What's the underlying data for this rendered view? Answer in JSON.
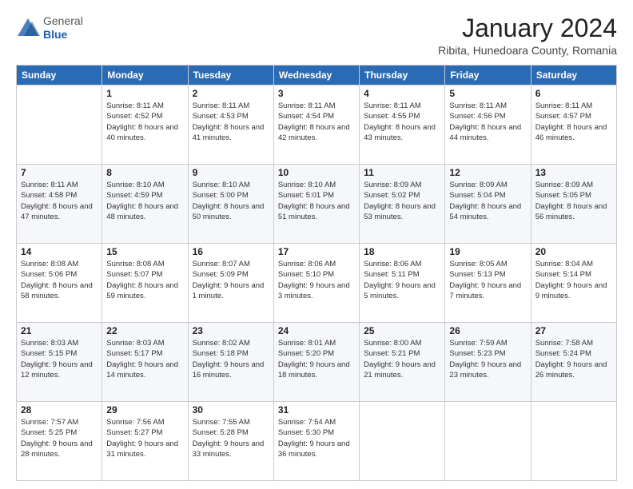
{
  "header": {
    "logo": {
      "general": "General",
      "blue": "Blue"
    },
    "title": "January 2024",
    "location": "Ribita, Hunedoara County, Romania"
  },
  "weekdays": [
    "Sunday",
    "Monday",
    "Tuesday",
    "Wednesday",
    "Thursday",
    "Friday",
    "Saturday"
  ],
  "weeks": [
    [
      {
        "day": "",
        "sunrise": "",
        "sunset": "",
        "daylight": ""
      },
      {
        "day": "1",
        "sunrise": "Sunrise: 8:11 AM",
        "sunset": "Sunset: 4:52 PM",
        "daylight": "Daylight: 8 hours and 40 minutes."
      },
      {
        "day": "2",
        "sunrise": "Sunrise: 8:11 AM",
        "sunset": "Sunset: 4:53 PM",
        "daylight": "Daylight: 8 hours and 41 minutes."
      },
      {
        "day": "3",
        "sunrise": "Sunrise: 8:11 AM",
        "sunset": "Sunset: 4:54 PM",
        "daylight": "Daylight: 8 hours and 42 minutes."
      },
      {
        "day": "4",
        "sunrise": "Sunrise: 8:11 AM",
        "sunset": "Sunset: 4:55 PM",
        "daylight": "Daylight: 8 hours and 43 minutes."
      },
      {
        "day": "5",
        "sunrise": "Sunrise: 8:11 AM",
        "sunset": "Sunset: 4:56 PM",
        "daylight": "Daylight: 8 hours and 44 minutes."
      },
      {
        "day": "6",
        "sunrise": "Sunrise: 8:11 AM",
        "sunset": "Sunset: 4:57 PM",
        "daylight": "Daylight: 8 hours and 46 minutes."
      }
    ],
    [
      {
        "day": "7",
        "sunrise": "Sunrise: 8:11 AM",
        "sunset": "Sunset: 4:58 PM",
        "daylight": "Daylight: 8 hours and 47 minutes."
      },
      {
        "day": "8",
        "sunrise": "Sunrise: 8:10 AM",
        "sunset": "Sunset: 4:59 PM",
        "daylight": "Daylight: 8 hours and 48 minutes."
      },
      {
        "day": "9",
        "sunrise": "Sunrise: 8:10 AM",
        "sunset": "Sunset: 5:00 PM",
        "daylight": "Daylight: 8 hours and 50 minutes."
      },
      {
        "day": "10",
        "sunrise": "Sunrise: 8:10 AM",
        "sunset": "Sunset: 5:01 PM",
        "daylight": "Daylight: 8 hours and 51 minutes."
      },
      {
        "day": "11",
        "sunrise": "Sunrise: 8:09 AM",
        "sunset": "Sunset: 5:02 PM",
        "daylight": "Daylight: 8 hours and 53 minutes."
      },
      {
        "day": "12",
        "sunrise": "Sunrise: 8:09 AM",
        "sunset": "Sunset: 5:04 PM",
        "daylight": "Daylight: 8 hours and 54 minutes."
      },
      {
        "day": "13",
        "sunrise": "Sunrise: 8:09 AM",
        "sunset": "Sunset: 5:05 PM",
        "daylight": "Daylight: 8 hours and 56 minutes."
      }
    ],
    [
      {
        "day": "14",
        "sunrise": "Sunrise: 8:08 AM",
        "sunset": "Sunset: 5:06 PM",
        "daylight": "Daylight: 8 hours and 58 minutes."
      },
      {
        "day": "15",
        "sunrise": "Sunrise: 8:08 AM",
        "sunset": "Sunset: 5:07 PM",
        "daylight": "Daylight: 8 hours and 59 minutes."
      },
      {
        "day": "16",
        "sunrise": "Sunrise: 8:07 AM",
        "sunset": "Sunset: 5:09 PM",
        "daylight": "Daylight: 9 hours and 1 minute."
      },
      {
        "day": "17",
        "sunrise": "Sunrise: 8:06 AM",
        "sunset": "Sunset: 5:10 PM",
        "daylight": "Daylight: 9 hours and 3 minutes."
      },
      {
        "day": "18",
        "sunrise": "Sunrise: 8:06 AM",
        "sunset": "Sunset: 5:11 PM",
        "daylight": "Daylight: 9 hours and 5 minutes."
      },
      {
        "day": "19",
        "sunrise": "Sunrise: 8:05 AM",
        "sunset": "Sunset: 5:13 PM",
        "daylight": "Daylight: 9 hours and 7 minutes."
      },
      {
        "day": "20",
        "sunrise": "Sunrise: 8:04 AM",
        "sunset": "Sunset: 5:14 PM",
        "daylight": "Daylight: 9 hours and 9 minutes."
      }
    ],
    [
      {
        "day": "21",
        "sunrise": "Sunrise: 8:03 AM",
        "sunset": "Sunset: 5:15 PM",
        "daylight": "Daylight: 9 hours and 12 minutes."
      },
      {
        "day": "22",
        "sunrise": "Sunrise: 8:03 AM",
        "sunset": "Sunset: 5:17 PM",
        "daylight": "Daylight: 9 hours and 14 minutes."
      },
      {
        "day": "23",
        "sunrise": "Sunrise: 8:02 AM",
        "sunset": "Sunset: 5:18 PM",
        "daylight": "Daylight: 9 hours and 16 minutes."
      },
      {
        "day": "24",
        "sunrise": "Sunrise: 8:01 AM",
        "sunset": "Sunset: 5:20 PM",
        "daylight": "Daylight: 9 hours and 18 minutes."
      },
      {
        "day": "25",
        "sunrise": "Sunrise: 8:00 AM",
        "sunset": "Sunset: 5:21 PM",
        "daylight": "Daylight: 9 hours and 21 minutes."
      },
      {
        "day": "26",
        "sunrise": "Sunrise: 7:59 AM",
        "sunset": "Sunset: 5:23 PM",
        "daylight": "Daylight: 9 hours and 23 minutes."
      },
      {
        "day": "27",
        "sunrise": "Sunrise: 7:58 AM",
        "sunset": "Sunset: 5:24 PM",
        "daylight": "Daylight: 9 hours and 26 minutes."
      }
    ],
    [
      {
        "day": "28",
        "sunrise": "Sunrise: 7:57 AM",
        "sunset": "Sunset: 5:25 PM",
        "daylight": "Daylight: 9 hours and 28 minutes."
      },
      {
        "day": "29",
        "sunrise": "Sunrise: 7:56 AM",
        "sunset": "Sunset: 5:27 PM",
        "daylight": "Daylight: 9 hours and 31 minutes."
      },
      {
        "day": "30",
        "sunrise": "Sunrise: 7:55 AM",
        "sunset": "Sunset: 5:28 PM",
        "daylight": "Daylight: 9 hours and 33 minutes."
      },
      {
        "day": "31",
        "sunrise": "Sunrise: 7:54 AM",
        "sunset": "Sunset: 5:30 PM",
        "daylight": "Daylight: 9 hours and 36 minutes."
      },
      {
        "day": "",
        "sunrise": "",
        "sunset": "",
        "daylight": ""
      },
      {
        "day": "",
        "sunrise": "",
        "sunset": "",
        "daylight": ""
      },
      {
        "day": "",
        "sunrise": "",
        "sunset": "",
        "daylight": ""
      }
    ]
  ]
}
